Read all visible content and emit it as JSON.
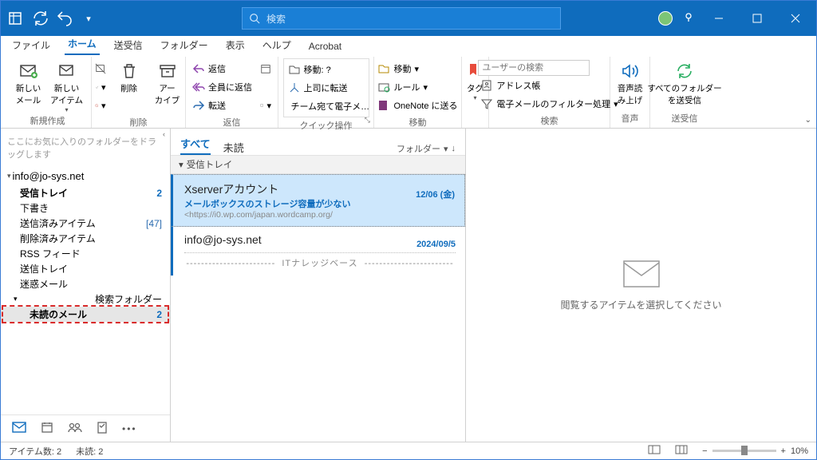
{
  "search": {
    "placeholder": "検索"
  },
  "menu": {
    "file": "ファイル",
    "home": "ホーム",
    "sendrecv": "送受信",
    "folder": "フォルダー",
    "view": "表示",
    "help": "ヘルプ",
    "acrobat": "Acrobat"
  },
  "ribbon": {
    "newmail": "新しい\nメール",
    "newitem": "新しい\nアイテム",
    "delete": "削除",
    "archive": "アー\nカイブ",
    "reply": "返信",
    "replyall": "全員に返信",
    "forward": "転送",
    "moveto": "移動: ?",
    "toboss": "上司に転送",
    "teammail": "チーム宛て電子メ…",
    "move": "移動",
    "rules": "ルール",
    "onenote": "OneNote に送る",
    "tag": "タグ",
    "search_ph": "ユーザーの検索",
    "addrbook": "アドレス帳",
    "filter": "電子メールのフィルター処理",
    "readaloud": "音声読\nみ上げ",
    "syncall": "すべてのフォルダー\nを送受信",
    "g_new": "新規作成",
    "g_del": "削除",
    "g_reply": "返信",
    "g_quick": "クイック操作",
    "g_move": "移動",
    "g_search": "検索",
    "g_voice": "音声",
    "g_sync": "送受信"
  },
  "folders": {
    "hint": "ここにお気に入りのフォルダーをドラッグします",
    "account": "info@jo-sys.net",
    "inbox": "受信トレイ",
    "inbox_count": "2",
    "drafts": "下書き",
    "sent": "送信済みアイテム",
    "sent_count": "[47]",
    "deleted": "削除済みアイテム",
    "rss": "RSS フィード",
    "outbox": "送信トレイ",
    "junk": "迷惑メール",
    "searchf": "検索フォルダー",
    "unread": "未読のメール",
    "unread_count": "2"
  },
  "maillist": {
    "all": "すべて",
    "unread": "未読",
    "folderdd": "フォルダー",
    "group1": "受信トレイ",
    "m1": {
      "from": "Xserverアカウント",
      "subj": "メールボックスのストレージ容量が少ない",
      "prev": "<https://i0.wp.com/japan.wordcamp.org/",
      "date": "12/06 (金)"
    },
    "m2": {
      "from": "info@jo-sys.net",
      "thread": "ITナレッジベース",
      "date": "2024/09/5"
    }
  },
  "reading": {
    "hint": "閲覧するアイテムを選択してください"
  },
  "status": {
    "items": "アイテム数: 2",
    "unread": "未読: 2",
    "zoom": "10%"
  }
}
